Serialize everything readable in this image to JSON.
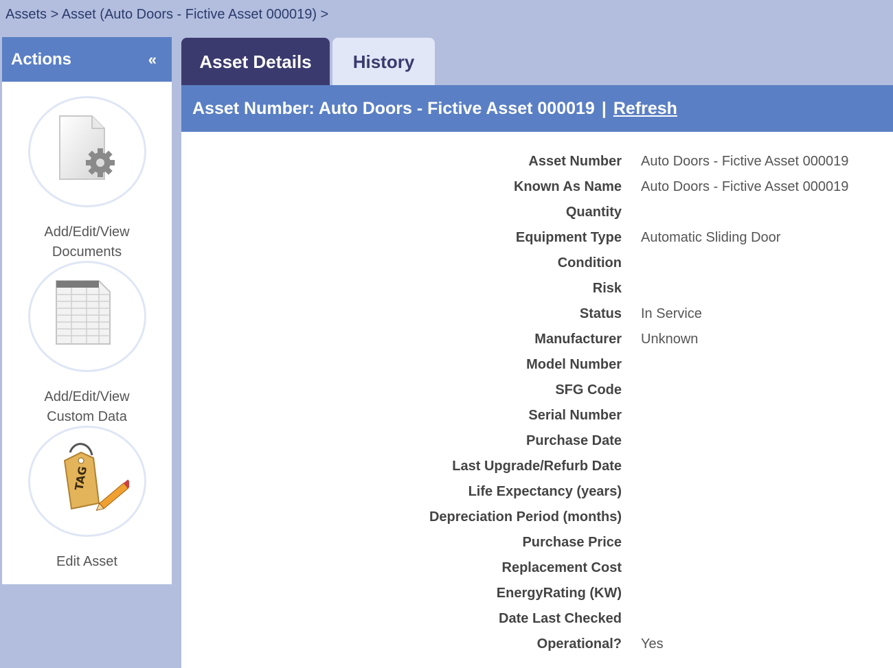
{
  "breadcrumb": "Assets > Asset (Auto Doors - Fictive Asset 000019) >",
  "sidebar": {
    "title": "Actions",
    "collapse": "«",
    "actions": [
      {
        "label": "Add/Edit/View Documents",
        "icon": "document-gear-icon"
      },
      {
        "label": "Add/Edit/View Custom Data",
        "icon": "spreadsheet-icon"
      },
      {
        "label": "Edit Asset",
        "icon": "tag-pencil-icon"
      }
    ]
  },
  "tabs": [
    {
      "label": "Asset Details",
      "active": true
    },
    {
      "label": "History",
      "active": false
    }
  ],
  "header": {
    "prefix": "Asset Number: Auto Doors - Fictive Asset 000019",
    "separator": "|",
    "refresh": "Refresh"
  },
  "fields": [
    {
      "label": "Asset Number",
      "value": "Auto Doors - Fictive Asset 000019"
    },
    {
      "label": "Known As Name",
      "value": "Auto Doors - Fictive Asset 000019"
    },
    {
      "label": "Quantity",
      "value": ""
    },
    {
      "label": "Equipment Type",
      "value": "Automatic Sliding Door"
    },
    {
      "label": "Condition",
      "value": ""
    },
    {
      "label": "Risk",
      "value": ""
    },
    {
      "label": "Status",
      "value": "In Service"
    },
    {
      "label": "Manufacturer",
      "value": "Unknown"
    },
    {
      "label": "Model Number",
      "value": ""
    },
    {
      "label": "SFG Code",
      "value": ""
    },
    {
      "label": "Serial Number",
      "value": ""
    },
    {
      "label": "Purchase Date",
      "value": ""
    },
    {
      "label": "Last Upgrade/Refurb Date",
      "value": ""
    },
    {
      "label": "Life Expectancy (years)",
      "value": ""
    },
    {
      "label": "Depreciation Period (months)",
      "value": ""
    },
    {
      "label": "Purchase Price",
      "value": ""
    },
    {
      "label": "Replacement Cost",
      "value": ""
    },
    {
      "label": "EnergyRating (KW)",
      "value": ""
    },
    {
      "label": "Date Last Checked",
      "value": ""
    },
    {
      "label": "Operational?",
      "value": "Yes"
    }
  ]
}
